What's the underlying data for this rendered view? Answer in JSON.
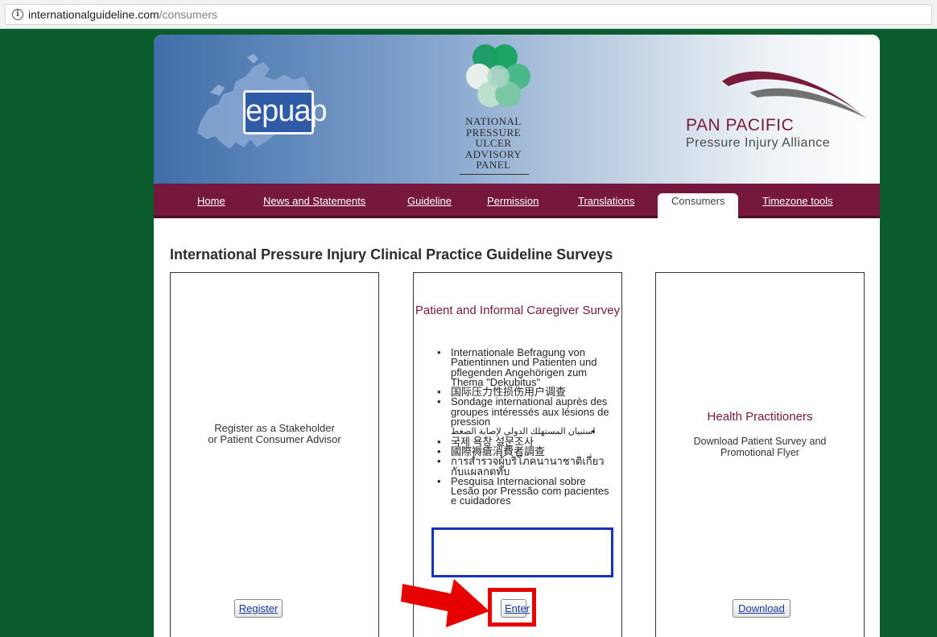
{
  "browser": {
    "url_host": "internationalguideline.com",
    "url_path": "/consumers"
  },
  "header": {
    "epuap_logo": "epuap",
    "npuap_lines": [
      "NATIONAL",
      "PRESSURE",
      "ULCER",
      "ADVISORY",
      "PANEL"
    ],
    "panpacific_title": "PAN PACIFIC",
    "panpacific_subtitle": "Pressure Injury Alliance"
  },
  "nav": {
    "items": [
      "Home",
      "News and Statements",
      "Guideline",
      "Permission",
      "Translations",
      "Consumers",
      "Timezone tools"
    ],
    "active": "Consumers"
  },
  "page_title": "International Pressure Injury Clinical Practice Guideline Surveys",
  "cards": {
    "register": {
      "text_line1": "Register as a Stakeholder",
      "text_line2": "or Patient Consumer Advisor",
      "button": "Register"
    },
    "patient": {
      "title": "Patient and Informal Caregiver Survey",
      "items": [
        "Internationale Befragung von Patientinnen und Patienten und pflegenden Angehörigen zum Thema \"Dekubitus\"",
        "国际压力性损伤用户调查",
        "Sondage international auprès des groupes intéressés aux lésions de pression",
        "استبيان المستهلك الدولي لإصابة الضغط",
        "국제 욕창 설문조사",
        "國際褥瘡消費者調查",
        "การสำรวจผู้บริโภคนานาชาติเกี่ยวกับแผลกดทับ",
        "Pesquisa Internacional sobre Lesão por Pressão com pacientes e cuidadores"
      ],
      "button": "Enter"
    },
    "health": {
      "title": "Health Practitioners",
      "text_line1": "Download Patient Survey and",
      "text_line2": "Promotional Flyer",
      "button": "Download"
    }
  },
  "colors": {
    "background": "#0a5c2c",
    "nav": "#76183e",
    "highlight": "#1733b8",
    "annotation": "#e60000"
  }
}
